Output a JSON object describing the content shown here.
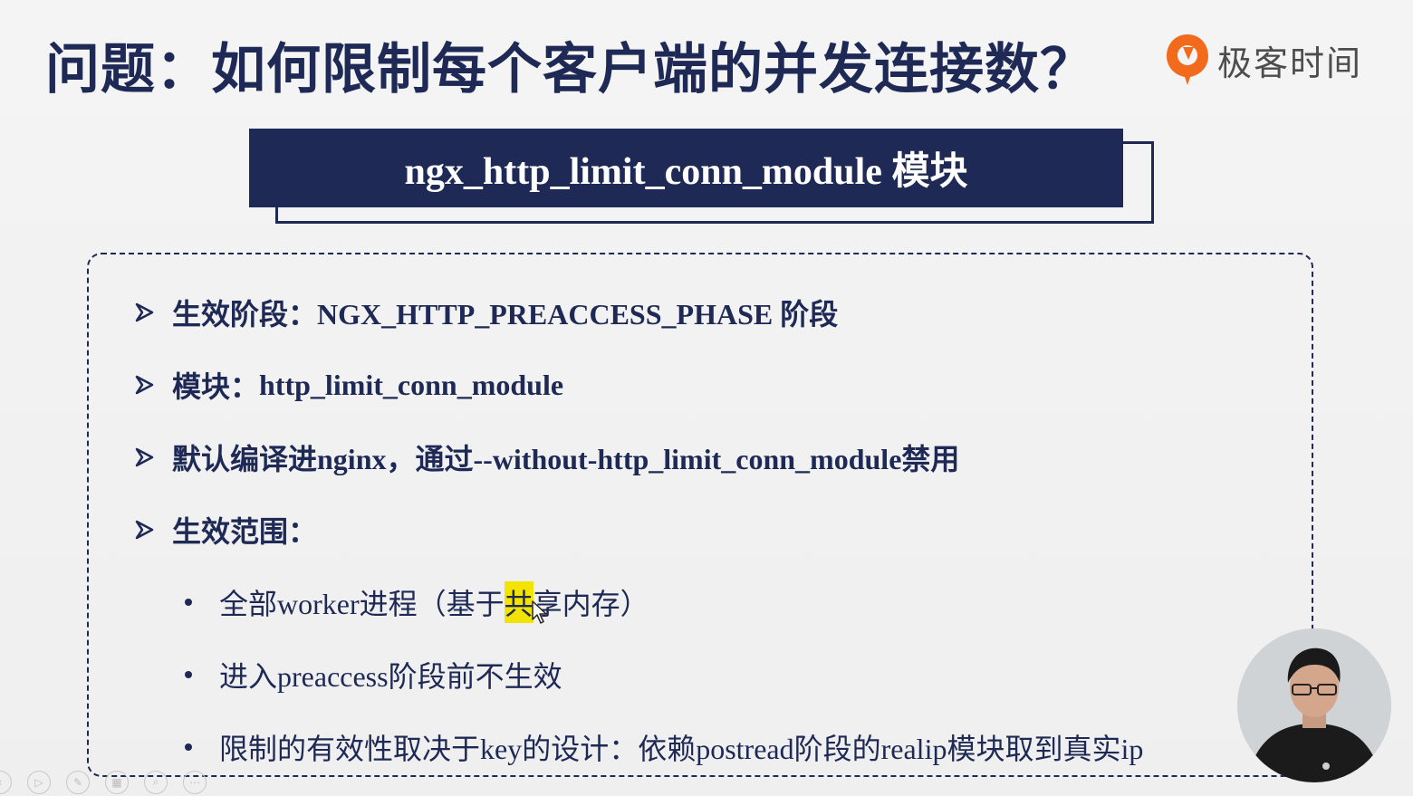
{
  "slide": {
    "title": "问题：如何限制每个客户端的并发连接数？",
    "brand": "极客时间",
    "banner": "ngx_http_limit_conn_module 模块",
    "items": [
      {
        "label": "生效阶段：",
        "text": "NGX_HTTP_PREACCESS_PHASE 阶段"
      },
      {
        "label": "模块：",
        "text": "http_limit_conn_module"
      },
      {
        "label": "默认编译进nginx，通过--without-http_limit_conn_module禁用",
        "text": ""
      },
      {
        "label": "生效范围：",
        "text": ""
      }
    ],
    "subitems": [
      {
        "before": "全部worker进程（基于",
        "highlight": "共",
        "after": "享内存）"
      },
      {
        "before": "进入preaccess阶段前不生效",
        "highlight": "",
        "after": ""
      },
      {
        "before": "限制的有效性取决于key的设计：依赖postread阶段的realip模块取到真实ip",
        "highlight": "",
        "after": ""
      }
    ]
  },
  "colors": {
    "navy": "#1e2a55",
    "brand_orange": "#f26b1d",
    "highlight": "#f2e300"
  },
  "player_toolbar": [
    "prev-icon",
    "play-icon",
    "pen-icon",
    "slides-icon",
    "zoom-icon",
    "more-icon"
  ]
}
